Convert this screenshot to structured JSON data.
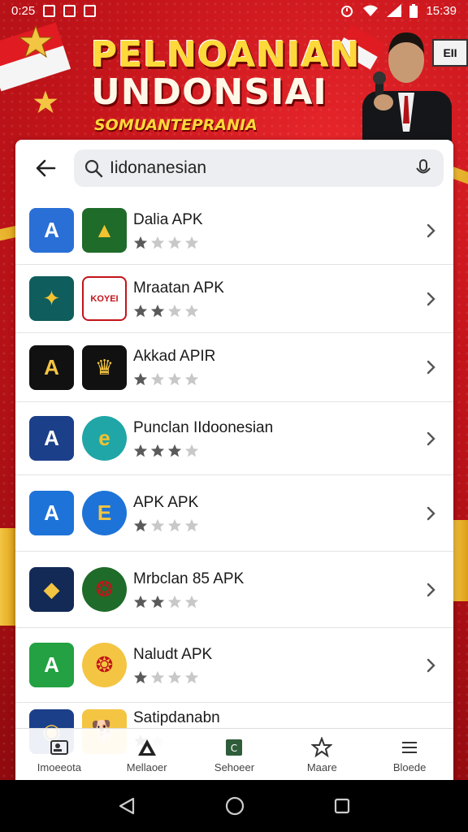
{
  "status_bar": {
    "time_left": "0:25",
    "time_right": "15:39"
  },
  "banner": {
    "title_line1": "PELNOANIAN",
    "title_line2": "UNDONSIAI",
    "subtitle": "SOMUANTEPRANIA",
    "sign_text": "EII"
  },
  "search": {
    "value": "Iidonanesian"
  },
  "results": [
    {
      "name": "Dalia APK",
      "rating": 1,
      "icon1": {
        "bg": "#2a6fd6",
        "fg": "#ffffff",
        "glyph": "A",
        "name": "apk-a-icon"
      },
      "icon2": {
        "bg": "#1f6b2a",
        "fg": "#f2c230",
        "glyph": "▲",
        "name": "emblem-icon"
      }
    },
    {
      "name": "Mraatan APK",
      "rating": 2,
      "icon1": {
        "bg": "#0f5d5d",
        "fg": "#f2c230",
        "glyph": "✦",
        "name": "garuda-icon"
      },
      "icon2": {
        "bg": "#ffffff",
        "fg": "#c3141a",
        "glyph": "KOYEI",
        "name": "flag-badge-icon"
      }
    },
    {
      "name": "Akkad APIR",
      "rating": 1,
      "icon1": {
        "bg": "#111111",
        "fg": "#f4c542",
        "glyph": "A",
        "name": "apk-a-icon"
      },
      "icon2": {
        "bg": "#111111",
        "fg": "#f4c542",
        "glyph": "♛",
        "name": "shield-icon"
      }
    },
    {
      "name": "Punclan IIdoonesian",
      "rating": 3,
      "icon1": {
        "bg": "#1c3f8a",
        "fg": "#ffffff",
        "glyph": "A",
        "name": "apk-a-icon"
      },
      "icon2": {
        "bg": "#20a6a6",
        "fg": "#f2c230",
        "glyph": "e",
        "name": "circle-badge-icon"
      }
    },
    {
      "name": "APK APK",
      "rating": 1,
      "icon1": {
        "bg": "#1e73d8",
        "fg": "#ffffff",
        "glyph": "A",
        "name": "apk-a-icon"
      },
      "icon2": {
        "bg": "#1e73d8",
        "fg": "#f4c542",
        "glyph": "E",
        "name": "circle-badge-icon"
      }
    },
    {
      "name": "Mrbclan 85 APK",
      "rating": 2,
      "icon1": {
        "bg": "#122a55",
        "fg": "#f4c542",
        "glyph": "◆",
        "name": "diamond-icon"
      },
      "icon2": {
        "bg": "#1f6b2a",
        "fg": "#c3141a",
        "glyph": "❂",
        "name": "seal-icon"
      }
    },
    {
      "name": "Naludt APK",
      "rating": 1,
      "icon1": {
        "bg": "#23a143",
        "fg": "#ffffff",
        "glyph": "A",
        "name": "apk-a-icon"
      },
      "icon2": {
        "bg": "#f4c542",
        "fg": "#c3141a",
        "glyph": "❂",
        "name": "seal-icon"
      }
    },
    {
      "name": "Satipdanabn",
      "rating": 1,
      "icon1": {
        "bg": "#1c3f8a",
        "fg": "#f4c542",
        "glyph": "◉",
        "name": "emblem-icon"
      },
      "icon2": {
        "bg": "#f4c542",
        "fg": "#3a2a10",
        "glyph": "🐕",
        "name": "dog-icon"
      }
    }
  ],
  "bottom_nav": [
    {
      "label": "Imoeeota",
      "icon": "person-card-icon"
    },
    {
      "label": "Mellaoer",
      "icon": "triangle-logo-icon"
    },
    {
      "label": "Sehoeer",
      "icon": "apps-icon"
    },
    {
      "label": "Maare",
      "icon": "star-gear-icon"
    },
    {
      "label": "Bloede",
      "icon": "menu-icon"
    }
  ],
  "colors": {
    "banner_red": "#c3141a",
    "gold": "#f4c542",
    "star_filled": "#5a5a5a",
    "star_empty": "#c8c8c8"
  }
}
